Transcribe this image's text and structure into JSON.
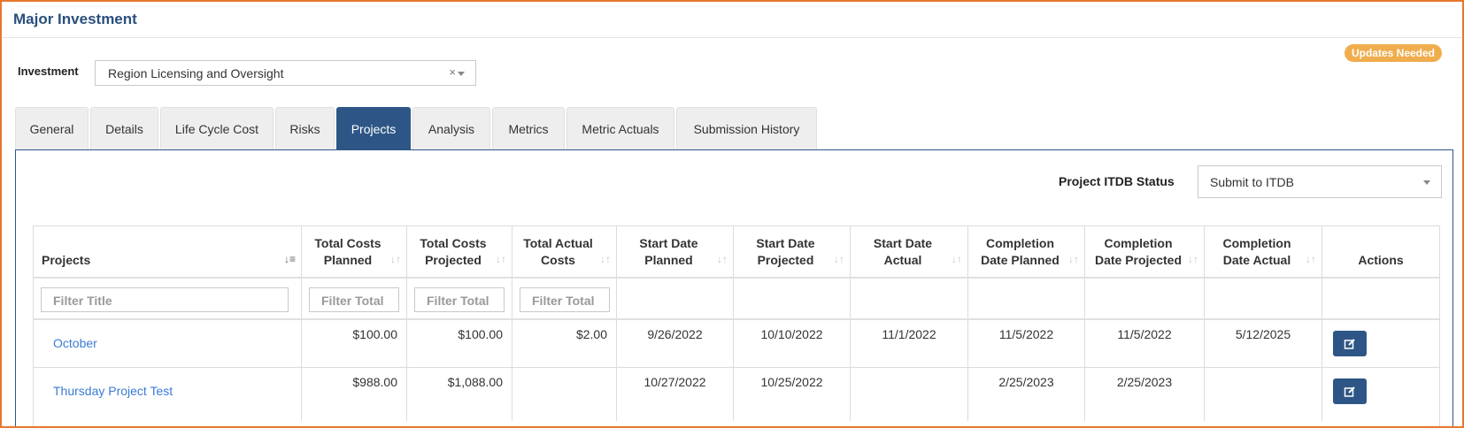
{
  "page": {
    "title": "Major Investment",
    "badge": "Updates Needed"
  },
  "investment": {
    "label": "Investment",
    "selected": "Region Licensing and Oversight",
    "clear_glyph": "×"
  },
  "tabs": [
    "General",
    "Details",
    "Life Cycle Cost",
    "Risks",
    "Projects",
    "Analysis",
    "Metrics",
    "Metric Actuals",
    "Submission History"
  ],
  "active_tab": "Projects",
  "status": {
    "label": "Project ITDB Status",
    "selected": "Submit to ITDB"
  },
  "table": {
    "columns": [
      {
        "line1": "Projects",
        "line2": ""
      },
      {
        "line1": "Total Costs",
        "line2": "Planned"
      },
      {
        "line1": "Total Costs",
        "line2": "Projected"
      },
      {
        "line1": "Total Actual",
        "line2": "Costs"
      },
      {
        "line1": "Start Date",
        "line2": "Planned"
      },
      {
        "line1": "Start Date",
        "line2": "Projected"
      },
      {
        "line1": "Start Date",
        "line2": "Actual"
      },
      {
        "line1": "Completion",
        "line2": "Date Planned"
      },
      {
        "line1": "Completion",
        "line2": "Date Projected"
      },
      {
        "line1": "Completion",
        "line2": "Date Actual"
      },
      {
        "line1": "Actions",
        "line2": ""
      }
    ],
    "filters": {
      "title": "Filter Title",
      "total": "Filter Total"
    },
    "rows": [
      {
        "project": "October",
        "planned": "$100.00",
        "projected": "$100.00",
        "actual": "$2.00",
        "start_planned": "9/26/2022",
        "start_projected": "10/10/2022",
        "start_actual": "11/1/2022",
        "comp_planned": "11/5/2022",
        "comp_projected": "11/5/2022",
        "comp_actual": "5/12/2025"
      },
      {
        "project": "Thursday Project Test",
        "planned": "$988.00",
        "projected": "$1,088.00",
        "actual": "",
        "start_planned": "10/27/2022",
        "start_projected": "10/25/2022",
        "start_actual": "",
        "comp_planned": "2/25/2023",
        "comp_projected": "2/25/2023",
        "comp_actual": ""
      }
    ]
  },
  "icons": {
    "sort": "sort-icon",
    "sort_alpha": "sort-alpha-icon",
    "edit": "edit-icon",
    "clear": "clear-icon",
    "dropdown": "chevron-down-icon"
  },
  "colors": {
    "brand": "#2d5687",
    "link": "#3a7bd5",
    "badge": "#f0ad4e",
    "frame": "#e8772e"
  }
}
